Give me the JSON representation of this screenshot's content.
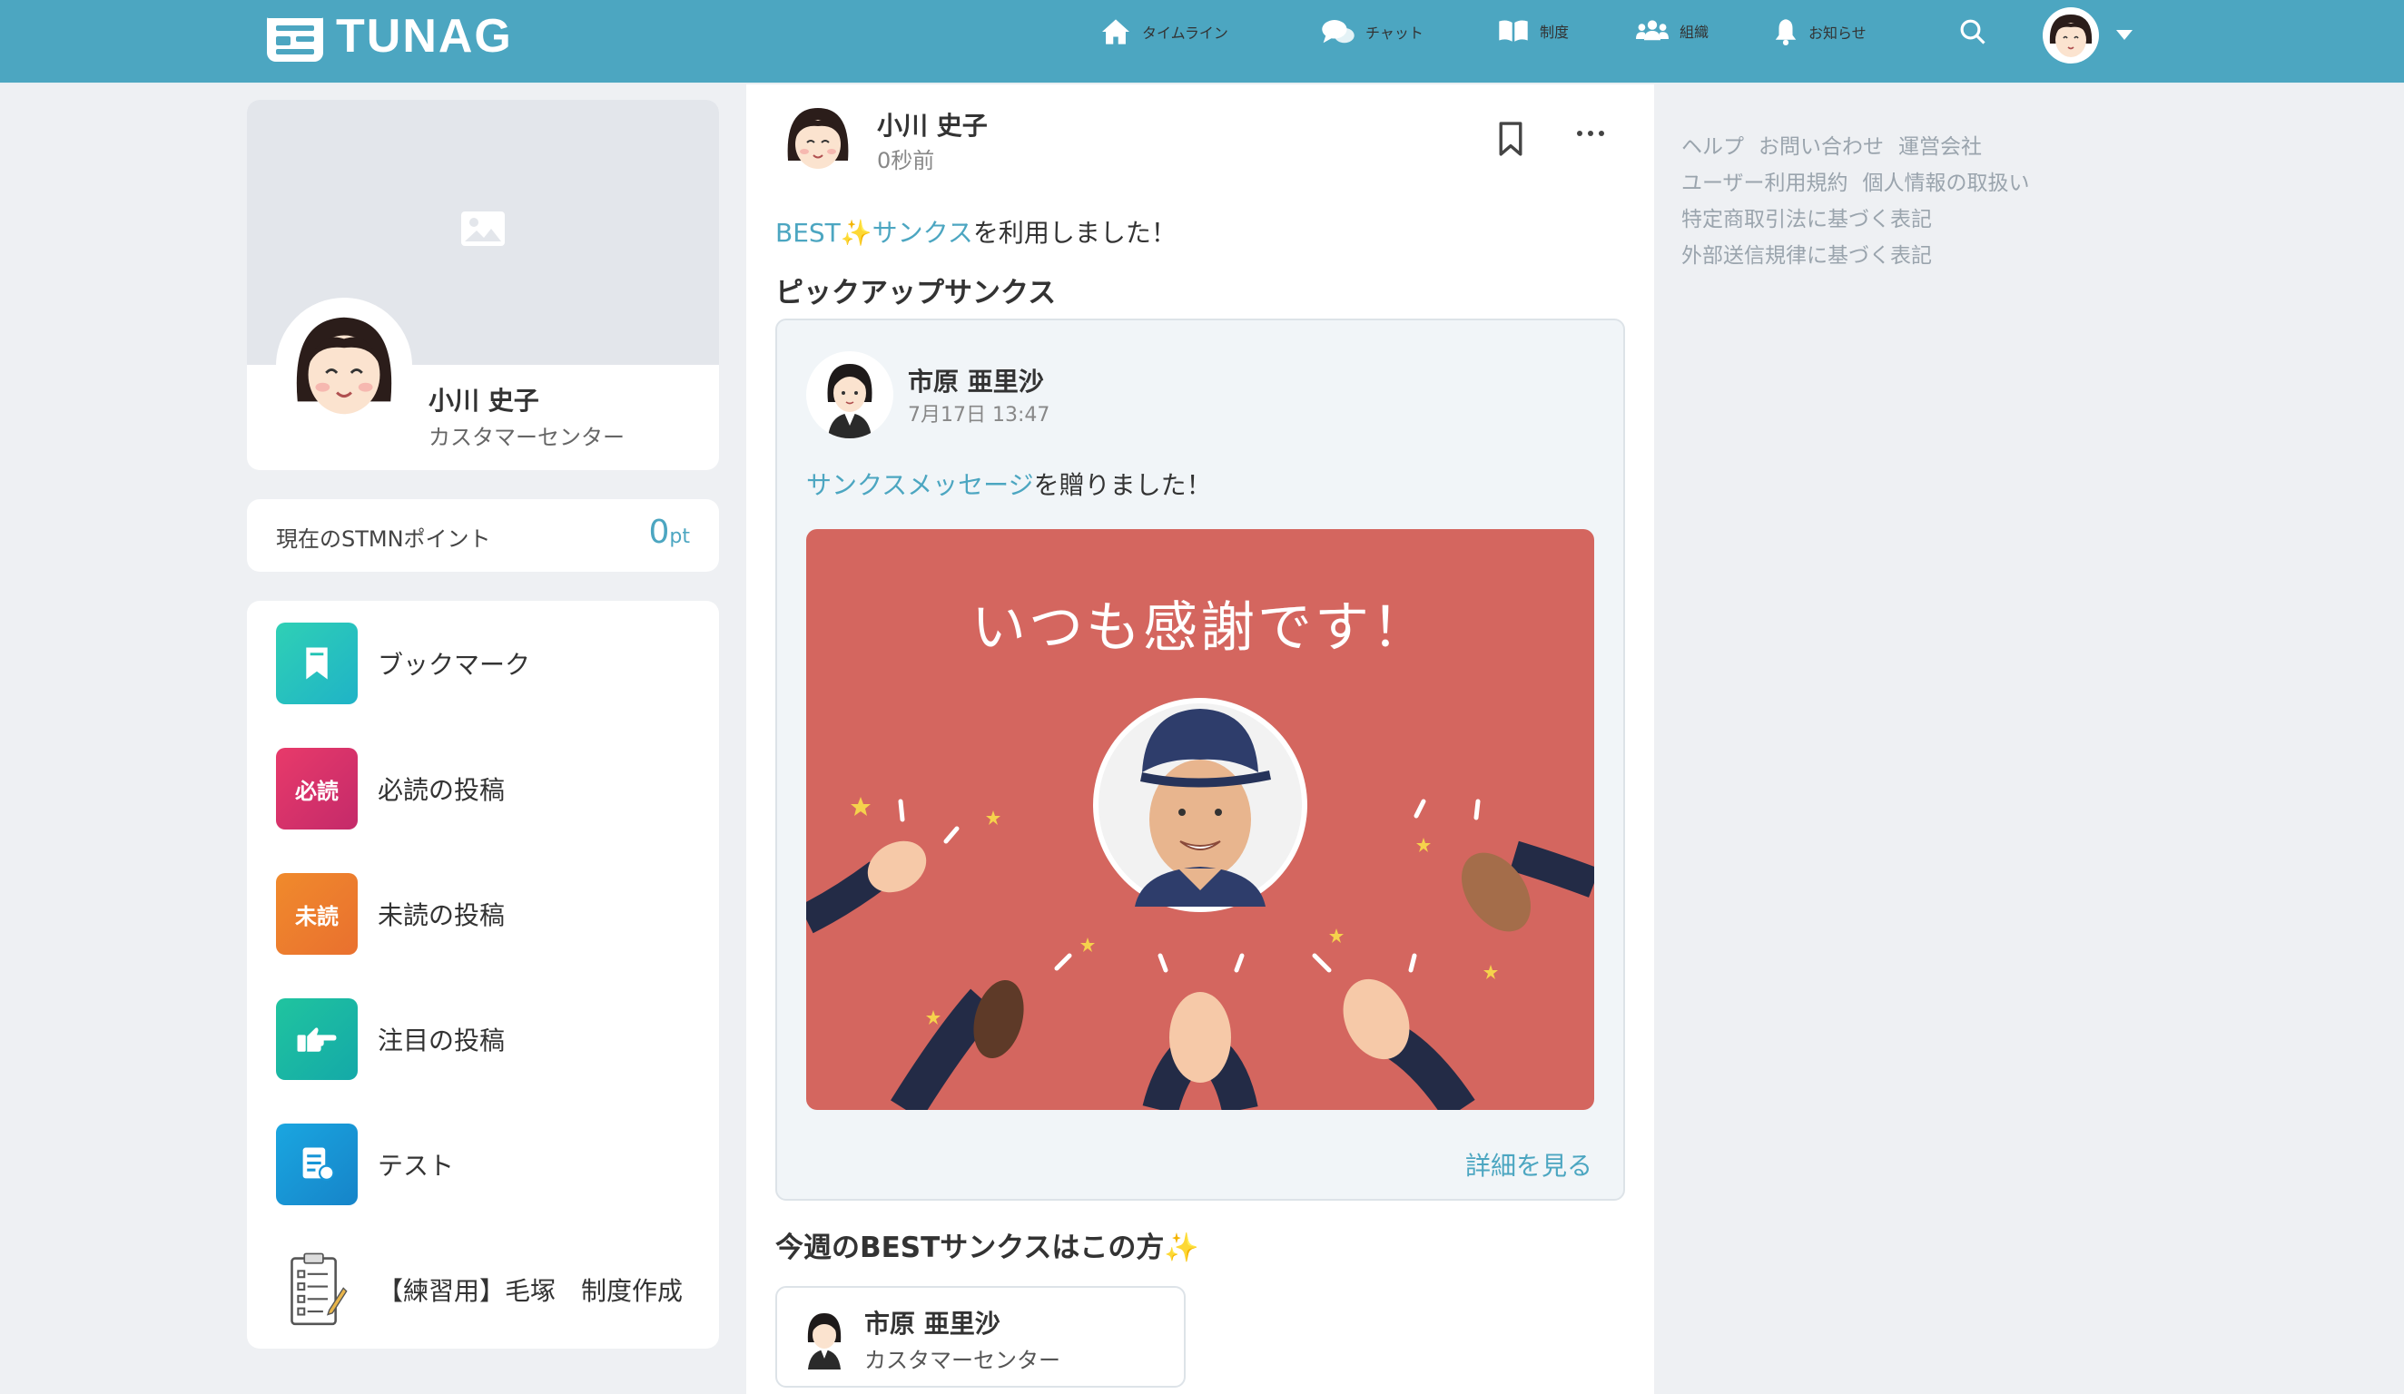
{
  "header": {
    "logo_text": "TUNAG",
    "nav": [
      {
        "label": "タイムライン",
        "icon": "home-icon"
      },
      {
        "label": "チャット",
        "icon": "chat-icon"
      },
      {
        "label": "制度",
        "icon": "book-icon"
      },
      {
        "label": "組織",
        "icon": "users-icon"
      },
      {
        "label": "お知らせ",
        "icon": "bell-icon"
      }
    ],
    "search_icon": "search-icon",
    "account_icon": "avatar"
  },
  "profile": {
    "name": "小川 史子",
    "department": "カスタマーセンター"
  },
  "points": {
    "label": "現在のSTMNポイント",
    "value": "0",
    "unit": "pt"
  },
  "menu": [
    {
      "label": "ブックマーク",
      "icon": "bookmark-icon",
      "color": "#22c3b4"
    },
    {
      "label": "必読の投稿",
      "icon_text": "必読",
      "color": "#d8326d"
    },
    {
      "label": "未読の投稿",
      "icon_text": "未読",
      "color": "#ee7f2e"
    },
    {
      "label": "注目の投稿",
      "icon": "pointing-hand-icon",
      "color": "#1bb5a5"
    },
    {
      "label": "テスト",
      "icon": "document-icon",
      "color": "#1795d7"
    },
    {
      "label": "【練習用】毛塚　制度作成",
      "icon": "clipboard-icon"
    }
  ],
  "post": {
    "author": "小川 史子",
    "time": "0秒前",
    "text_link": "BEST✨サンクス",
    "text_rest": "を利用しました！",
    "pickup_title": "ピックアップサンクス",
    "thanks": {
      "author": "市原 亜里沙",
      "time": "7月17日 13:47",
      "text_link": "サンクスメッセージ",
      "text_rest": "を贈りました！",
      "card_message": "いつも感謝です！",
      "card_bg": "#d4665f",
      "detail_label": "詳細を見る"
    },
    "best_title": "今週のBESTサンクスはこの方",
    "best_person": {
      "name": "市原 亜里沙",
      "department": "カスタマーセンター"
    }
  },
  "footer_links": [
    [
      "ヘルプ",
      "お問い合わせ",
      "運営会社"
    ],
    [
      "ユーザー利用規約",
      "個人情報の取扱い"
    ],
    [
      "特定商取引法に基づく表記"
    ],
    [
      "外部送信規律に基づく表記"
    ]
  ],
  "colors": {
    "brand": "#4ca6c1",
    "link": "#4ca6c1",
    "background": "#eef0f3"
  }
}
